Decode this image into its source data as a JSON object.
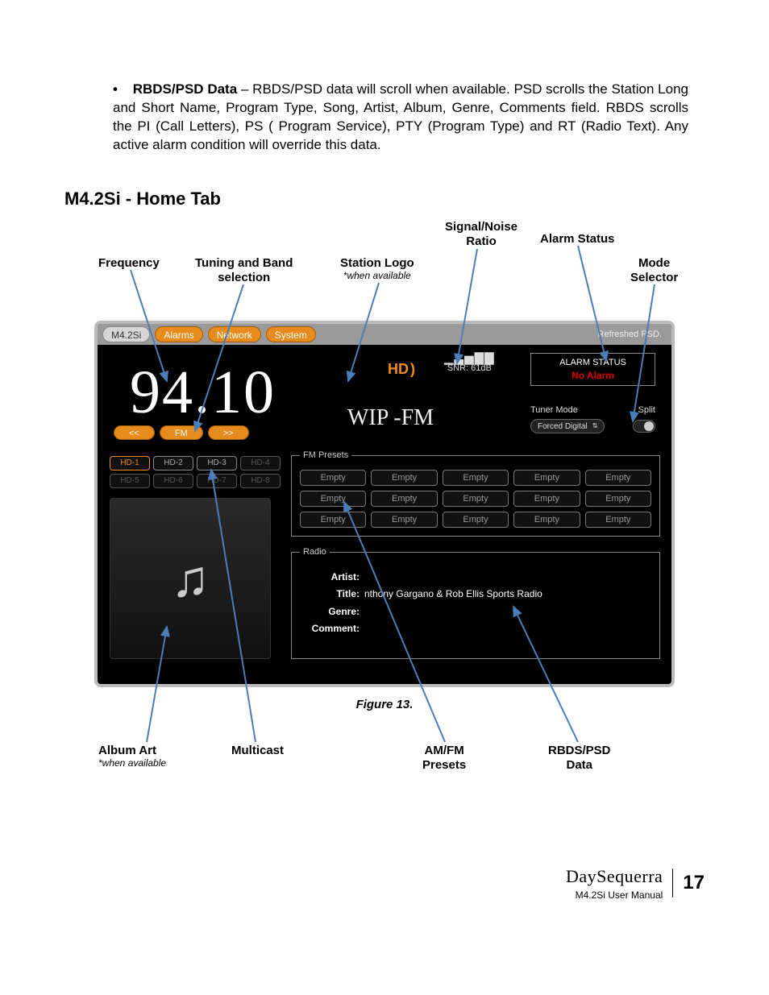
{
  "bullet": {
    "heading": "RBDS/PSD Data",
    "text": " – RBDS/PSD data will scroll when available.  PSD scrolls the Station Long and Short Name, Program Type, Song, Artist, Album, Genre, Comments field.  RBDS scrolls the PI (Call Letters), PS ( Program Service), PTY (Program Type) and RT (Radio Text).  Any active alarm condition will override this data."
  },
  "section_title": "M4.2Si - Home Tab",
  "annotations": {
    "top": {
      "frequency": "Frequency",
      "tuning": "Tuning and Band\nselection",
      "station_logo": "Station Logo",
      "station_logo_sub": "*when available",
      "snr": "Signal/Noise\nRatio",
      "alarm_status": "Alarm Status",
      "mode_selector": "Mode\nSelector"
    },
    "bottom": {
      "album_art": "Album Art",
      "album_art_sub": "*when available",
      "multicast": "Multicast",
      "amfm_presets": "AM/FM\nPresets",
      "rbds_psd": "RBDS/PSD\nData"
    }
  },
  "screen": {
    "tabs": {
      "main": "M4.2Si",
      "alarms": "Alarms",
      "network": "Network",
      "system": "System"
    },
    "refreshed": "Refreshed PSD.",
    "frequency": "94.10",
    "tune": {
      "prev": "<<",
      "band": "FM",
      "next": ">>"
    },
    "hd_buttons": [
      "HD-1",
      "HD-2",
      "HD-3",
      "HD-4",
      "HD-5",
      "HD-6",
      "HD-7",
      "HD-8"
    ],
    "hd_logo": "HD",
    "snr_value": "SNR: 61dB",
    "station": "WIP -FM",
    "alarm": {
      "label": "ALARM STATUS",
      "value": "No Alarm"
    },
    "mode": {
      "tuner_label": "Tuner Mode",
      "split_label": "Split",
      "dropdown": "Forced Digital"
    },
    "presets": {
      "legend": "FM Presets",
      "buttons": [
        "Empty",
        "Empty",
        "Empty",
        "Empty",
        "Empty",
        "Empty",
        "Empty",
        "Empty",
        "Empty",
        "Empty",
        "Empty",
        "Empty",
        "Empty",
        "Empty",
        "Empty"
      ]
    },
    "radio": {
      "legend": "Radio",
      "artist_label": "Artist:",
      "artist": "",
      "title_label": "Title:",
      "title": "nthony Gargano & Rob Ellis Sports Radio",
      "genre_label": "Genre:",
      "genre": "",
      "comment_label": "Comment:",
      "comment": ""
    }
  },
  "figure_caption": "Figure 13.",
  "footer": {
    "brand": "DaySequerra",
    "manual": "M4.2Si User Manual",
    "page": "17"
  }
}
